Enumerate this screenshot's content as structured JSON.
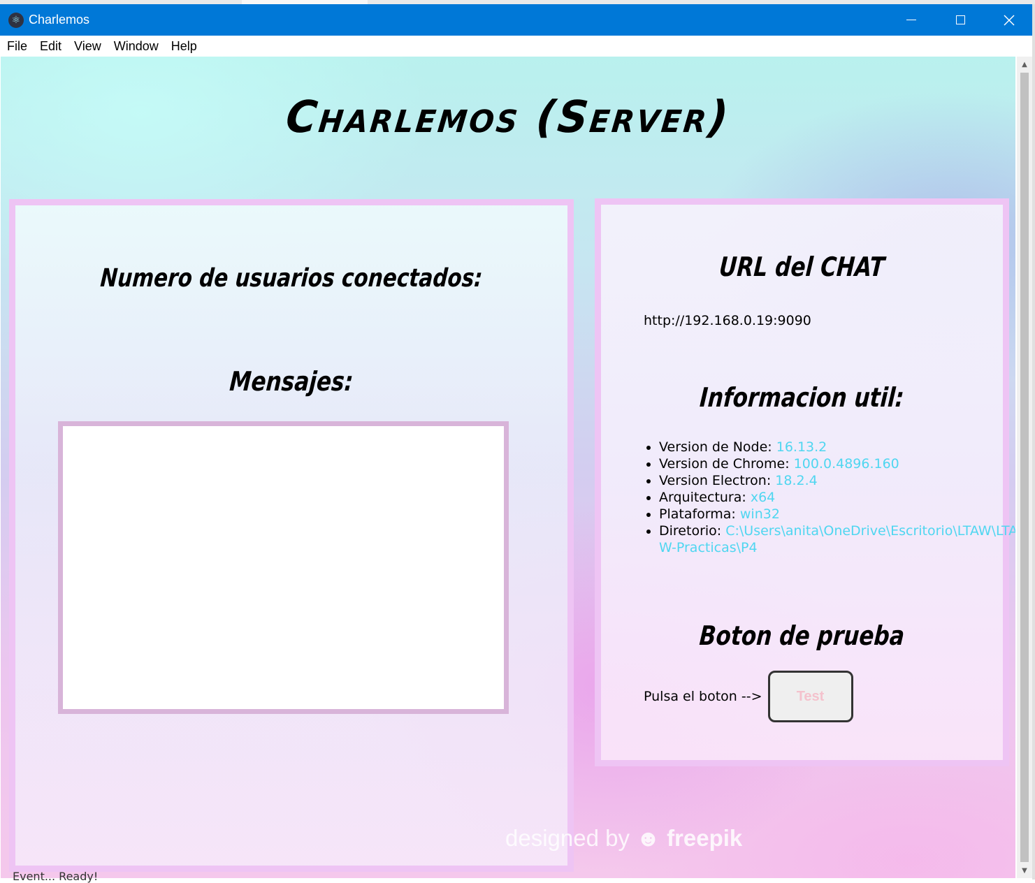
{
  "window": {
    "title": "Charlemos",
    "controls": [
      "minimize",
      "maximize",
      "close"
    ]
  },
  "menu": [
    "File",
    "Edit",
    "View",
    "Window",
    "Help"
  ],
  "page": {
    "title": "Charlemos (Server)",
    "left_panel": {
      "users_heading": "Numero de usuarios conectados:",
      "messages_heading": "Mensajes:"
    },
    "right_panel": {
      "url_heading": "URL del CHAT",
      "url": "http://192.168.0.19:9090",
      "info_heading": "Informacion util:",
      "info": [
        {
          "label": "Version de Node:",
          "value": "16.13.2"
        },
        {
          "label": "Version de Chrome:",
          "value": "100.0.4896.160"
        },
        {
          "label": "Version Electron:",
          "value": "18.2.4"
        },
        {
          "label": "Arquitectura:",
          "value": "x64"
        },
        {
          "label": "Plataforma:",
          "value": "win32"
        },
        {
          "label": "Diretorio:",
          "value": "C:\\Users\\anita\\OneDrive\\Escritorio\\LTAW\\LTAW-Practicas\\P4"
        }
      ],
      "test_heading": "Boton de prueba",
      "test_label": "Pulsa el boton -->",
      "test_button": "Test"
    },
    "watermark": {
      "prefix": "designed by",
      "brand": "freepik"
    },
    "status_text": "Event... Ready!"
  },
  "colors": {
    "titlebar": "#0078d7",
    "panel_border": "#eec4f4",
    "message_box_border": "#d8b4d9",
    "info_value": "#4fd6f0",
    "test_button_text": "#f4c2cd"
  },
  "icons": {
    "app": "electron-atom-icon",
    "minimize": "minimize-icon",
    "maximize": "maximize-icon",
    "close": "close-icon",
    "watermark_logo": "freepik-logo-icon"
  }
}
